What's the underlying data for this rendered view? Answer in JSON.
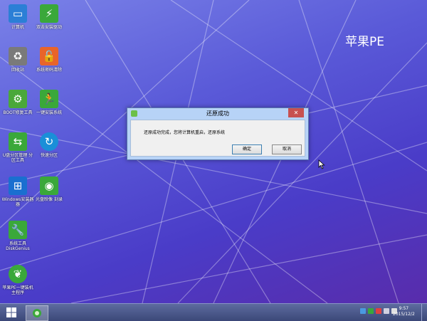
{
  "desktop": {
    "brand": "苹果PE",
    "icons": [
      {
        "label": "计算机",
        "icon": "computer-icon",
        "color": "#2b7fd6"
      },
      {
        "label": "双击安装驱动",
        "icon": "lightning-icon",
        "color": "#3aa83a"
      },
      {
        "label": "回收站",
        "icon": "recycle-bin-icon",
        "color": "#7a7a7a"
      },
      {
        "label": "系统密码清除",
        "icon": "unlock-icon",
        "color": "#e8642a"
      },
      {
        "label": "BOOT修复工具",
        "icon": "gear-icon",
        "color": "#4aa83a"
      },
      {
        "label": "一键安装系统",
        "icon": "running-man-icon",
        "color": "#3aa83a"
      },
      {
        "label": "U盘分区管理 分区工具",
        "icon": "partition-icon",
        "color": "#3aa83a"
      },
      {
        "label": "快速分区",
        "icon": "refresh-icon",
        "color": "#1a8fd8"
      },
      {
        "label": "Windows安装器 器",
        "icon": "windows-icon",
        "color": "#1a6fd0"
      },
      {
        "label": "光盘映像 刻录",
        "icon": "disc-icon",
        "color": "#3aa83a"
      },
      {
        "label": "系统工具 DiskGenius",
        "icon": "wrench-icon",
        "color": "#3aa83a"
      },
      {
        "label": "苹果PE一键装机 主程序",
        "icon": "apple-pe-icon",
        "color": "#3aa83a"
      }
    ]
  },
  "dialog": {
    "title": "还原成功",
    "message": "还原成功完成，您将计算机重启，还原系统",
    "ok_label": "确定",
    "cancel_label": "取消",
    "close_label": "✕"
  },
  "taskbar": {
    "clock_time": "9:57",
    "clock_date": "2015/12/2"
  }
}
